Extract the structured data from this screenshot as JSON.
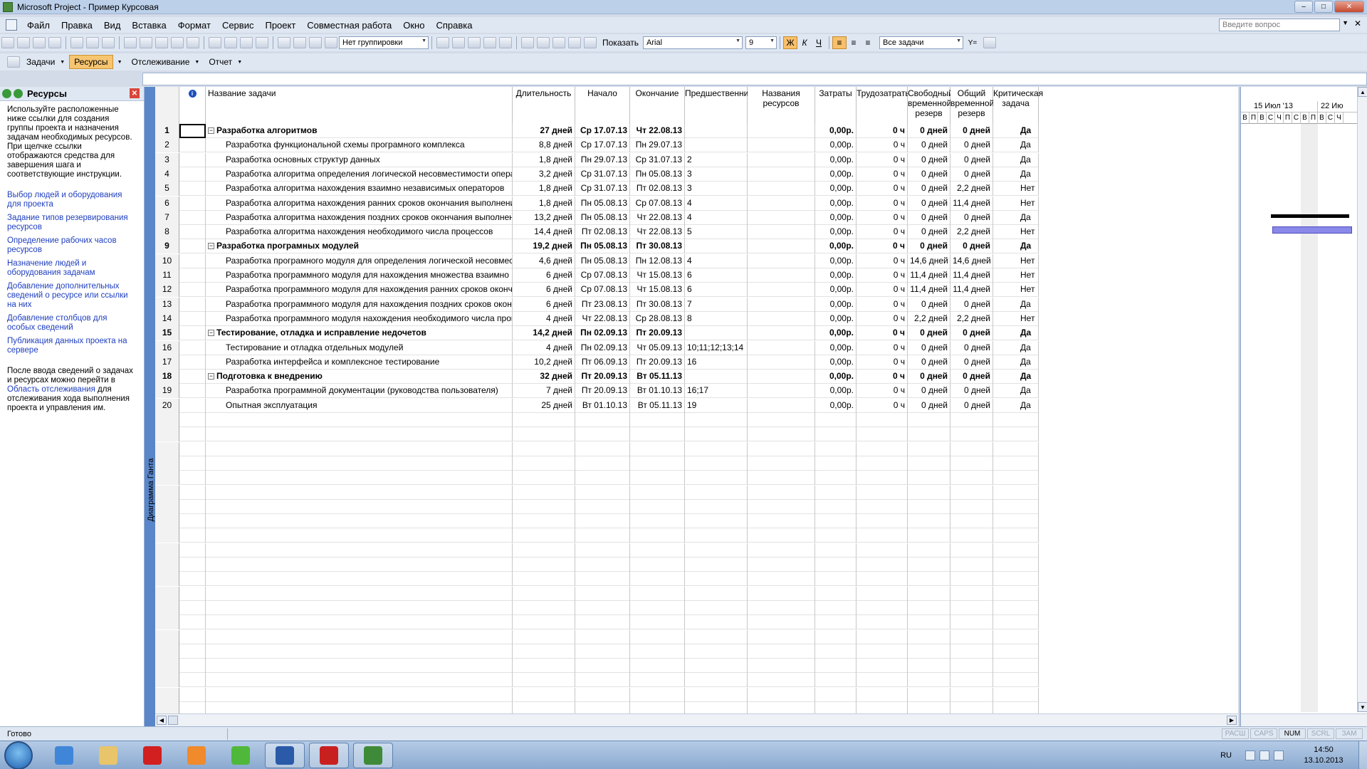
{
  "window": {
    "title": "Microsoft Project - Пример Курсовая",
    "minimize": "–",
    "maximize": "□",
    "close": "✕"
  },
  "menu": {
    "items": [
      "Файл",
      "Правка",
      "Вид",
      "Вставка",
      "Формат",
      "Сервис",
      "Проект",
      "Совместная работа",
      "Окно",
      "Справка"
    ],
    "help_placeholder": "Введите вопрос",
    "close": "✕",
    "drop": "▼"
  },
  "toolbar": {
    "grouping": "Нет группировки",
    "show_label": "Показать",
    "font": "Arial",
    "font_size": "9",
    "bold": "Ж",
    "italic": "К",
    "underline": "Ч",
    "filter": "Все задачи",
    "filter_icon": "Y="
  },
  "viewbar": {
    "items": [
      "Задачи",
      "Ресурсы",
      "Отслеживание",
      "Отчет"
    ]
  },
  "sidepane": {
    "title": "Ресурсы",
    "close": "✕",
    "intro": "Используйте расположенные ниже ссылки для создания группы проекта и назначения задачам необходимых ресурсов. При щелчке ссылки отображаются средства для завершения шага и соответствующие инструкции.",
    "links": [
      "Выбор людей и оборудования для проекта",
      "Задание типов резервирования ресурсов",
      "Определение рабочих часов ресурсов",
      "Назначение людей и оборудования задачам",
      "Добавление дополнительных сведений о ресурсе или ссылки на них",
      "Добавление столбцов для особых сведений",
      "Публикация данных проекта на сервере"
    ],
    "outro_before": "После ввода сведений о задачах и ресурсах можно перейти в ",
    "outro_link": "Область отслеживания",
    "outro_after": " для отслеживания хода выполнения проекта и управления им."
  },
  "view_label": "Диаграмма Ганта",
  "grid": {
    "info_icon": "i",
    "columns": [
      "Название задачи",
      "Длительность",
      "Начало",
      "Окончание",
      "Предшественники",
      "Названия ресурсов",
      "Затраты",
      "Трудозатраты",
      "Свободный временной резерв",
      "Общий временной резерв",
      "Критическая задача"
    ],
    "collapse_glyph": "−",
    "rows": [
      {
        "id": "1",
        "name": "Разработка алгоритмов",
        "summary": true,
        "dur": "27 дней",
        "start": "Ср 17.07.13",
        "finish": "Чт 22.08.13",
        "pred": "",
        "res": "",
        "cost": "0,00р.",
        "work": "0 ч",
        "free": "0 дней",
        "total": "0 дней",
        "crit": "Да"
      },
      {
        "id": "2",
        "name": "Разработка функциональной схемы програмного комплекса",
        "summary": false,
        "dur": "8,8 дней",
        "start": "Ср 17.07.13",
        "finish": "Пн 29.07.13",
        "pred": "",
        "res": "",
        "cost": "0,00р.",
        "work": "0 ч",
        "free": "0 дней",
        "total": "0 дней",
        "crit": "Да"
      },
      {
        "id": "3",
        "name": "Разработка основных структур данных",
        "summary": false,
        "dur": "1,8 дней",
        "start": "Пн 29.07.13",
        "finish": "Ср 31.07.13",
        "pred": "2",
        "res": "",
        "cost": "0,00р.",
        "work": "0 ч",
        "free": "0 дней",
        "total": "0 дней",
        "crit": "Да"
      },
      {
        "id": "4",
        "name": "Разработка алгоритма определения логической несовместимости операторов",
        "summary": false,
        "dur": "3,2 дней",
        "start": "Ср 31.07.13",
        "finish": "Пн 05.08.13",
        "pred": "3",
        "res": "",
        "cost": "0,00р.",
        "work": "0 ч",
        "free": "0 дней",
        "total": "0 дней",
        "crit": "Да"
      },
      {
        "id": "5",
        "name": "Разработка алгоритма нахождения взаимно независимых операторов",
        "summary": false,
        "dur": "1,8 дней",
        "start": "Ср 31.07.13",
        "finish": "Пт 02.08.13",
        "pred": "3",
        "res": "",
        "cost": "0,00р.",
        "work": "0 ч",
        "free": "0 дней",
        "total": "2,2 дней",
        "crit": "Нет"
      },
      {
        "id": "6",
        "name": "Разработка алгоритма нахождения ранних сроков окончания выполнения операторов",
        "summary": false,
        "dur": "1,8 дней",
        "start": "Пн 05.08.13",
        "finish": "Ср 07.08.13",
        "pred": "4",
        "res": "",
        "cost": "0,00р.",
        "work": "0 ч",
        "free": "0 дней",
        "total": "11,4 дней",
        "crit": "Нет"
      },
      {
        "id": "7",
        "name": "Разработка алгоритма нахождения поздних сроков окончания выполнения операторов",
        "summary": false,
        "dur": "13,2 дней",
        "start": "Пн 05.08.13",
        "finish": "Чт 22.08.13",
        "pred": "4",
        "res": "",
        "cost": "0,00р.",
        "work": "0 ч",
        "free": "0 дней",
        "total": "0 дней",
        "crit": "Да"
      },
      {
        "id": "8",
        "name": "Разработка алгоритма нахождения необходимого числа процессов",
        "summary": false,
        "dur": "14,4 дней",
        "start": "Пт 02.08.13",
        "finish": "Чт 22.08.13",
        "pred": "5",
        "res": "",
        "cost": "0,00р.",
        "work": "0 ч",
        "free": "0 дней",
        "total": "2,2 дней",
        "crit": "Нет"
      },
      {
        "id": "9",
        "name": "Разработка програмных модулей",
        "summary": true,
        "dur": "19,2 дней",
        "start": "Пн 05.08.13",
        "finish": "Пт 30.08.13",
        "pred": "",
        "res": "",
        "cost": "0,00р.",
        "work": "0 ч",
        "free": "0 дней",
        "total": "0 дней",
        "crit": "Да"
      },
      {
        "id": "10",
        "name": "Разработка програмного модуля для определения логической несовместимости операторов",
        "summary": false,
        "dur": "4,6 дней",
        "start": "Пн 05.08.13",
        "finish": "Пн 12.08.13",
        "pred": "4",
        "res": "",
        "cost": "0,00р.",
        "work": "0 ч",
        "free": "14,6 дней",
        "total": "14,6 дней",
        "crit": "Нет"
      },
      {
        "id": "11",
        "name": "Разработка программного модуля для нахождения множества взаимно независимых операторов",
        "summary": false,
        "dur": "6 дней",
        "start": "Ср 07.08.13",
        "finish": "Чт 15.08.13",
        "pred": "6",
        "res": "",
        "cost": "0,00р.",
        "work": "0 ч",
        "free": "11,4 дней",
        "total": "11,4 дней",
        "crit": "Нет"
      },
      {
        "id": "12",
        "name": "Разработка программного модуля для нахождения ранних сроков окончания выполнения операторов",
        "summary": false,
        "dur": "6 дней",
        "start": "Ср 07.08.13",
        "finish": "Чт 15.08.13",
        "pred": "6",
        "res": "",
        "cost": "0,00р.",
        "work": "0 ч",
        "free": "11,4 дней",
        "total": "11,4 дней",
        "crit": "Нет"
      },
      {
        "id": "13",
        "name": "Разработка программного модуля для нахождения поздних сроков окончания выполнения операторов",
        "summary": false,
        "dur": "6 дней",
        "start": "Пт 23.08.13",
        "finish": "Пт 30.08.13",
        "pred": "7",
        "res": "",
        "cost": "0,00р.",
        "work": "0 ч",
        "free": "0 дней",
        "total": "0 дней",
        "crit": "Да"
      },
      {
        "id": "14",
        "name": "Разработка программного модуля нахождения необходимого числа процессов",
        "summary": false,
        "dur": "4 дней",
        "start": "Чт 22.08.13",
        "finish": "Ср 28.08.13",
        "pred": "8",
        "res": "",
        "cost": "0,00р.",
        "work": "0 ч",
        "free": "2,2 дней",
        "total": "2,2 дней",
        "crit": "Нет"
      },
      {
        "id": "15",
        "name": "Тестирование, отладка и исправление недочетов",
        "summary": true,
        "dur": "14,2 дней",
        "start": "Пн 02.09.13",
        "finish": "Пт 20.09.13",
        "pred": "",
        "res": "",
        "cost": "0,00р.",
        "work": "0 ч",
        "free": "0 дней",
        "total": "0 дней",
        "crit": "Да"
      },
      {
        "id": "16",
        "name": "Тестирование и отладка отдельных модулей",
        "summary": false,
        "dur": "4 дней",
        "start": "Пн 02.09.13",
        "finish": "Чт 05.09.13",
        "pred": "10;11;12;13;14",
        "res": "",
        "cost": "0,00р.",
        "work": "0 ч",
        "free": "0 дней",
        "total": "0 дней",
        "crit": "Да"
      },
      {
        "id": "17",
        "name": "Разработка интерфейса и комплексное тестирование",
        "summary": false,
        "dur": "10,2 дней",
        "start": "Пт 06.09.13",
        "finish": "Пт 20.09.13",
        "pred": "16",
        "res": "",
        "cost": "0,00р.",
        "work": "0 ч",
        "free": "0 дней",
        "total": "0 дней",
        "crit": "Да"
      },
      {
        "id": "18",
        "name": "Подготовка к внедрению",
        "summary": true,
        "dur": "32 дней",
        "start": "Пт 20.09.13",
        "finish": "Вт 05.11.13",
        "pred": "",
        "res": "",
        "cost": "0,00р.",
        "work": "0 ч",
        "free": "0 дней",
        "total": "0 дней",
        "crit": "Да"
      },
      {
        "id": "19",
        "name": "Разработка программной документации (руководства пользователя)",
        "summary": false,
        "dur": "7 дней",
        "start": "Пт 20.09.13",
        "finish": "Вт 01.10.13",
        "pred": "16;17",
        "res": "",
        "cost": "0,00р.",
        "work": "0 ч",
        "free": "0 дней",
        "total": "0 дней",
        "crit": "Да"
      },
      {
        "id": "20",
        "name": "Опытная эксплуатация",
        "summary": false,
        "dur": "25 дней",
        "start": "Вт 01.10.13",
        "finish": "Вт 05.11.13",
        "pred": "19",
        "res": "",
        "cost": "0,00р.",
        "work": "0 ч",
        "free": "0 дней",
        "total": "0 дней",
        "crit": "Да"
      }
    ]
  },
  "gantt": {
    "weeks": [
      "15 Июл '13",
      "22 Ию"
    ],
    "days": [
      "В",
      "П",
      "В",
      "С",
      "Ч",
      "П",
      "С",
      "В",
      "П",
      "В",
      "С",
      "Ч"
    ],
    "up_arrow": "▲",
    "down_arrow": "▼",
    "left_arrow": "◀",
    "right_arrow": "▶"
  },
  "statusbar": {
    "text": "Готово",
    "indicators": [
      {
        "label": "РАСШ",
        "on": false
      },
      {
        "label": "CAPS",
        "on": false
      },
      {
        "label": "NUM",
        "on": true
      },
      {
        "label": "SCRL",
        "on": false
      },
      {
        "label": "ЗАМ",
        "on": false
      }
    ]
  },
  "taskbar": {
    "apps": [
      {
        "name": "internet-explorer",
        "color": "#3f86d8",
        "running": false
      },
      {
        "name": "file-explorer",
        "color": "#e8c46a",
        "running": false
      },
      {
        "name": "opera",
        "color": "#d21f1f",
        "running": false
      },
      {
        "name": "media-player",
        "color": "#f08a2a",
        "running": false
      },
      {
        "name": "icq",
        "color": "#4fb83a",
        "running": false
      },
      {
        "name": "word",
        "color": "#2a5aa8",
        "running": true
      },
      {
        "name": "pdf-reader",
        "color": "#c8201f",
        "running": true
      },
      {
        "name": "ms-project",
        "color": "#3f8a38",
        "running": true
      }
    ],
    "lang": "RU",
    "time": "14:50",
    "date": "13.10.2013"
  }
}
